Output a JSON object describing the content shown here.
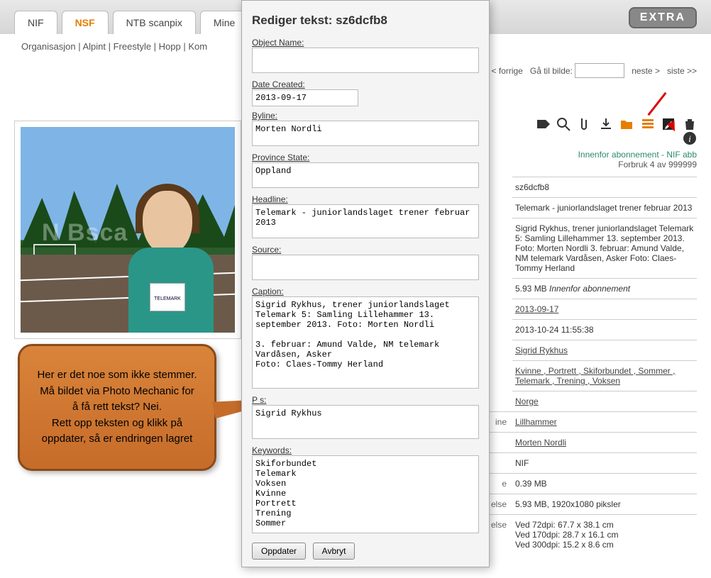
{
  "tabs": {
    "t0": "NIF",
    "t1": "NSF",
    "t2": "NTB scanpix",
    "t3": "Mine"
  },
  "extra": "EXTRA",
  "subnav": "Organisasjon  |  Alpint  |  Freestyle  |  Hopp  |  Kom",
  "nav": {
    "prev": "< forrige",
    "goto": "Gå til bilde:",
    "next": "neste >",
    "last": "siste >>"
  },
  "modal": {
    "title": "Rediger tekst: sz6dcfb8",
    "labels": {
      "object": "Object Name:",
      "date": "Date Created:",
      "byline": "Byline:",
      "province": "Province State:",
      "headline": "Headline:",
      "source": "Source:",
      "caption": "Caption:",
      "persons_label_visible": "P        s:",
      "keywords": "Keywords:"
    },
    "values": {
      "object": "",
      "date": "2013-09-17",
      "byline": "Morten Nordli",
      "province": "Oppland",
      "headline": "Telemark - juniorlandslaget trener februar 2013",
      "source": "",
      "caption": "Sigrid Rykhus, trener juniorlandslaget Telemark 5: Samling Lillehammer 13. september 2013. Foto: Morten Nordli\n\n3. februar: Amund Valde, NM telemark Vardåsen, Asker\nFoto: Claes-Tommy Herland",
      "persons": "Sigrid Rykhus",
      "keywords": "Skiforbundet\nTelemark\nVoksen\nKvinne\nPortrett\nTrening\nSommer"
    },
    "btn_update": "Oppdater",
    "btn_cancel": "Avbryt"
  },
  "callout": "Her er det noe som ikke stemmer. Må bildet via Photo Mechanic for å få rett tekst? Nei.\nRett opp teksten og klikk på oppdater, så er endringen lagret",
  "sidebar": {
    "sub1": "Innenfor abonnement - NIF abb",
    "sub2": "Forbruk 4 av 999999",
    "id": "sz6dcfb8",
    "title": "Telemark - juniorlandslaget trener februar 2013",
    "desc": "Sigrid Rykhus, trener juniorlandslaget Telemark 5: Samling Lillehammer 13. september 2013. Foto: Morten Nordli 3. februar: Amund Valde, NM telemark Vardåsen, Asker Foto: Claes-Tommy Herland",
    "size1": "5.93 MB ",
    "size1b": "Innenfor abonnement",
    "date1": "2013-09-17",
    "date2": "2013-10-24 11:55:38",
    "person": "Sigrid Rykhus",
    "tags": "Kvinne , Portrett , Skiforbundet , Sommer , Telemark , Trening , Voksen",
    "country": "Norge",
    "city_lab": "ine",
    "city": "Lillhammer",
    "photog": "Morten Nordli",
    "org": "NIF",
    "small_lab": "e",
    "small": "0.39 MB",
    "big_lab": "else",
    "big": "5.93 MB, 1920x1080 piksler",
    "dpi_lab": "else",
    "dpi": "Ved   72dpi: 67.7 x 38.1 cm\nVed 170dpi: 28.7 x 16.1 cm\nVed 300dpi: 15.2 x 8.6 cm"
  },
  "badge_text": "TELEMARK"
}
